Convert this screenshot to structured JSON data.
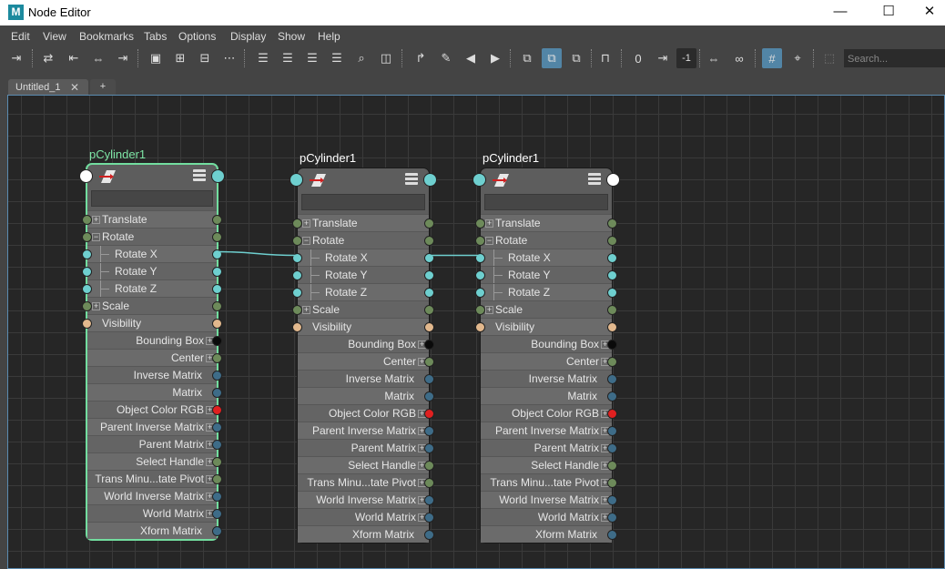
{
  "window": {
    "title": "Node Editor",
    "logo": "M",
    "minimize_icon": "minimize-icon",
    "maximize_icon": "maximize-icon",
    "close_icon": "close-icon"
  },
  "menu": [
    "Edit",
    "View",
    "Bookmarks",
    "Tabs",
    "Options",
    "Display",
    "Show",
    "Help"
  ],
  "toolbar": {
    "counter_value": "-1",
    "search_placeholder": "Search..."
  },
  "tabs": [
    {
      "label": "Untitled_1",
      "close": "✕"
    },
    {
      "label": "+"
    }
  ],
  "colors": {
    "selected_outline": "#72dd9f",
    "port_gray": "#6d8a5a",
    "port_cyan": "#6ecfcf",
    "port_tan": "#e2b88d",
    "port_blue": "#3e6c88",
    "port_red": "#e02020",
    "port_black": "#0a0a0a",
    "wire": "#6ecfcf"
  },
  "nodes": [
    {
      "name": "pCylinder1",
      "selected": true,
      "in_port_color": "#ffffff",
      "out_port_color": "#6ecfcf"
    },
    {
      "name": "pCylinder1",
      "selected": false,
      "in_port_color": "#6ecfcf",
      "out_port_color": "#6ecfcf"
    },
    {
      "name": "pCylinder1",
      "selected": false,
      "in_port_color": "#6ecfcf",
      "out_port_color": "#ffffff"
    }
  ],
  "attributes": [
    {
      "label": "Translate",
      "kind": "compound",
      "expander": "+",
      "in": "#6d8a5a",
      "out": "#6d8a5a"
    },
    {
      "label": "Rotate",
      "kind": "compound",
      "expander": "−",
      "in": "#6d8a5a",
      "out": "#6d8a5a"
    },
    {
      "label": "Rotate X",
      "kind": "child",
      "in": "#6ecfcf",
      "out": "#6ecfcf"
    },
    {
      "label": "Rotate Y",
      "kind": "child",
      "in": "#6ecfcf",
      "out": "#6ecfcf"
    },
    {
      "label": "Rotate Z",
      "kind": "child",
      "in": "#6ecfcf",
      "out": "#6ecfcf"
    },
    {
      "label": "Scale",
      "kind": "compound",
      "expander": "+",
      "in": "#6d8a5a",
      "out": "#6d8a5a"
    },
    {
      "label": "Visibility",
      "kind": "simple",
      "in": "#e2b88d",
      "out": "#e2b88d"
    },
    {
      "label": "Bounding Box",
      "kind": "output",
      "expander": "+",
      "out": "#0a0a0a"
    },
    {
      "label": "Center",
      "kind": "output",
      "expander": "+",
      "out": "#6d8a5a"
    },
    {
      "label": "Inverse Matrix",
      "kind": "output",
      "out": "#3e6c88"
    },
    {
      "label": "Matrix",
      "kind": "output",
      "out": "#3e6c88"
    },
    {
      "label": "Object Color RGB",
      "kind": "output",
      "expander": "+",
      "out": "#e02020"
    },
    {
      "label": "Parent Inverse Matrix",
      "kind": "output",
      "expander": "+",
      "out": "#3e6c88"
    },
    {
      "label": "Parent Matrix",
      "kind": "output",
      "expander": "+",
      "out": "#3e6c88"
    },
    {
      "label": "Select Handle",
      "kind": "output",
      "expander": "+",
      "out": "#6d8a5a"
    },
    {
      "label": "Trans Minu...tate Pivot",
      "kind": "output",
      "expander": "+",
      "out": "#6d8a5a"
    },
    {
      "label": "World Inverse Matrix",
      "kind": "output",
      "expander": "+",
      "out": "#3e6c88"
    },
    {
      "label": "World Matrix",
      "kind": "output",
      "expander": "+",
      "out": "#3e6c88"
    },
    {
      "label": "Xform Matrix",
      "kind": "output",
      "out": "#3e6c88"
    }
  ],
  "connections": [
    {
      "from_node": 0,
      "from_attr": "Rotate X",
      "to_node": 1,
      "to_attr": "Rotate X"
    },
    {
      "from_node": 1,
      "from_attr": "Rotate X",
      "to_node": 2,
      "to_attr": "Rotate X"
    }
  ]
}
